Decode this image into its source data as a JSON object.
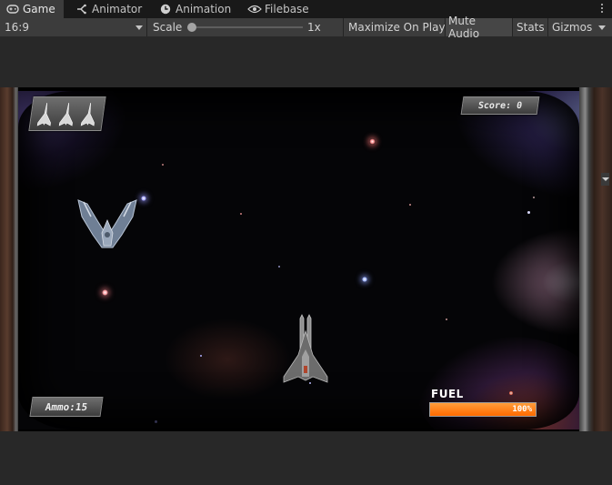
{
  "tabs": [
    {
      "label": "Game",
      "icon": "gamepad-icon",
      "active": true
    },
    {
      "label": "Animator",
      "icon": "animator-icon",
      "active": false
    },
    {
      "label": "Animation",
      "icon": "clock-icon",
      "active": false
    },
    {
      "label": "Filebase",
      "icon": "eye-icon",
      "active": false
    }
  ],
  "toolbar": {
    "aspect": "16:9",
    "scale_label": "Scale",
    "scale_value": "1x",
    "scale_level": 0.0,
    "maximize_on_play": "Maximize On Play",
    "mute_audio": "Mute Audio",
    "stats": "Stats",
    "gizmos": "Gizmos"
  },
  "game": {
    "score_text": "Score: 0",
    "ammo_text": "Ammo:15",
    "fuel_label": "FUEL",
    "fuel_text": "100%",
    "fuel_level": 1.0,
    "lives": 3
  },
  "colors": {
    "editor_bg": "#282828",
    "tabbar_bg": "#191919",
    "toolbar_bg": "#3c3c3c",
    "fuel_orange": "#ff7a14"
  }
}
